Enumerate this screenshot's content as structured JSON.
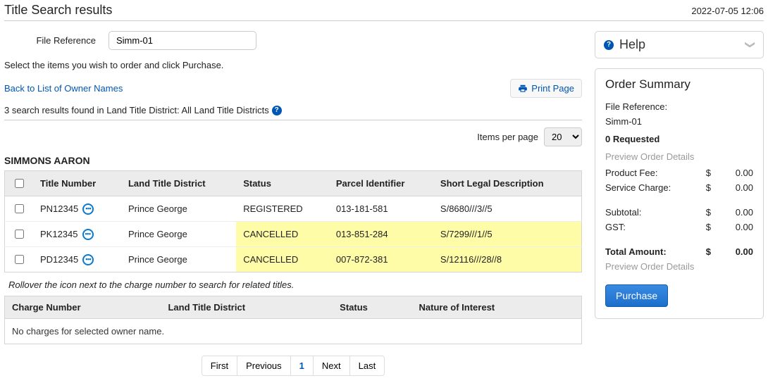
{
  "header": {
    "title": "Title Search results",
    "timestamp": "2022-07-05 12:06"
  },
  "fileref": {
    "label": "File Reference",
    "value": "Simm-01"
  },
  "instruction": "Select the items you wish to order and click Purchase.",
  "back_link": "Back to List of Owner Names",
  "print_label": "Print Page",
  "results_summary": "3 search results found in Land Title District: All Land Title Districts",
  "items_per_page": {
    "label": "Items per page",
    "value": "20"
  },
  "owner_name": "SIMMONS AARON",
  "titles_table": {
    "headers": [
      "Title Number",
      "Land Title District",
      "Status",
      "Parcel Identifier",
      "Short Legal Description"
    ],
    "rows": [
      {
        "title_number": "PN12345",
        "district": "Prince George",
        "status": "REGISTERED",
        "parcel": "013-181-581",
        "legal": "S/8680///3//5",
        "cancelled": false
      },
      {
        "title_number": "PK12345",
        "district": "Prince George",
        "status": "CANCELLED",
        "parcel": "013-851-284",
        "legal": "S/7299///1//5",
        "cancelled": true
      },
      {
        "title_number": "PD12345",
        "district": "Prince George",
        "status": "CANCELLED",
        "parcel": "007-872-381",
        "legal": "S/12116///28//8",
        "cancelled": true
      }
    ]
  },
  "rollover_hint": "Rollover the icon next to the charge number to search for related titles.",
  "charges_table": {
    "headers": [
      "Charge Number",
      "Land Title District",
      "Status",
      "Nature of Interest"
    ],
    "empty": "No charges for selected owner name."
  },
  "pager": {
    "first": "First",
    "prev": "Previous",
    "page": "1",
    "next": "Next",
    "last": "Last"
  },
  "help_panel": {
    "title": "Help"
  },
  "order_summary": {
    "title": "Order Summary",
    "fileref_label": "File Reference:",
    "fileref_value": "Simm-01",
    "requested": "0 Requested",
    "preview": "Preview Order Details",
    "currency": "$",
    "fees": [
      {
        "label": "Product Fee:",
        "amount": "0.00"
      },
      {
        "label": "Service Charge:",
        "amount": "0.00"
      }
    ],
    "subtotal": {
      "label": "Subtotal:",
      "amount": "0.00"
    },
    "gst": {
      "label": "GST:",
      "amount": "0.00"
    },
    "total": {
      "label": "Total Amount:",
      "amount": "0.00"
    },
    "purchase_label": "Purchase"
  }
}
